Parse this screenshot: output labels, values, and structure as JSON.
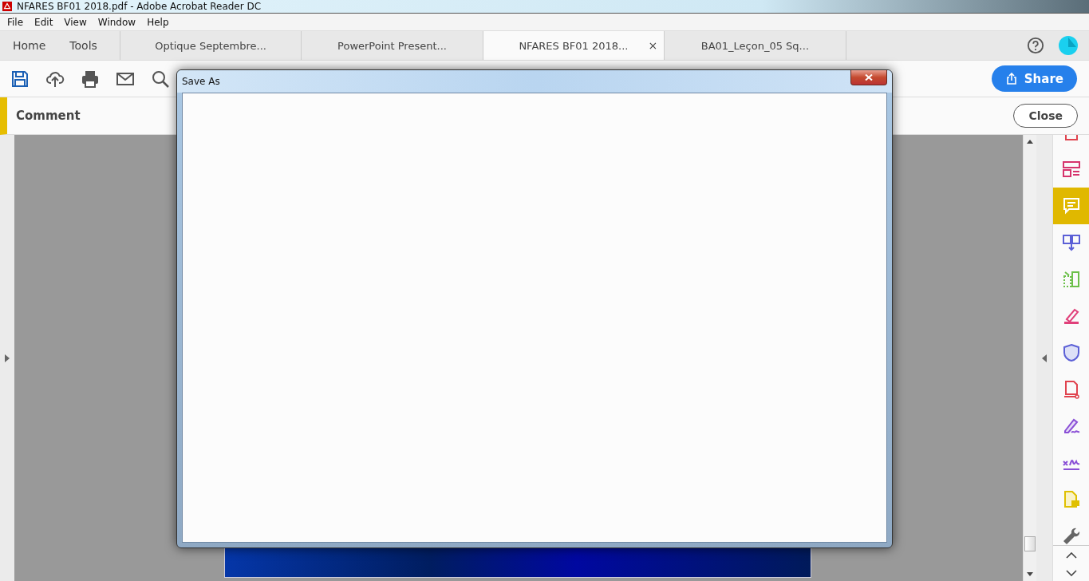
{
  "window": {
    "title": "NFARES BF01 2018.pdf - Adobe Acrobat Reader DC"
  },
  "menu": [
    "File",
    "Edit",
    "View",
    "Window",
    "Help"
  ],
  "tabs": [
    {
      "label": "Home",
      "kind": "nav",
      "selected": false
    },
    {
      "label": "Tools",
      "kind": "nav",
      "selected": false
    },
    {
      "label": "Optique Septembre...",
      "kind": "doc",
      "selected": false
    },
    {
      "label": "PowerPoint Present...",
      "kind": "doc",
      "selected": false
    },
    {
      "label": "NFARES BF01 2018...",
      "kind": "doc",
      "selected": true,
      "close": "×"
    },
    {
      "label": "BA01_Leçon_05 Sq...",
      "kind": "doc",
      "selected": false
    }
  ],
  "toolbar": {
    "share": "Share"
  },
  "panel": {
    "title": "Comment",
    "close": "Close"
  },
  "rail": [
    {
      "kind": "page",
      "color": "#e0434e",
      "selected": false
    },
    {
      "kind": "layout",
      "color": "#d6336c",
      "selected": false
    },
    {
      "kind": "comment",
      "color": "#ffffff",
      "selected": true
    },
    {
      "kind": "combine",
      "color": "#5b5fd6",
      "selected": false
    },
    {
      "kind": "organize",
      "color": "#6cc04a",
      "selected": false
    },
    {
      "kind": "highlight",
      "color": "#e0407a",
      "selected": false
    },
    {
      "kind": "shield",
      "color": "#5b5fd6",
      "selected": false
    },
    {
      "kind": "export",
      "color": "#e0434e",
      "selected": false
    },
    {
      "kind": "sign",
      "color": "#8a4fd6",
      "selected": false
    },
    {
      "kind": "fill",
      "color": "#8a4fd6",
      "selected": false
    },
    {
      "kind": "note",
      "color": "#e0c000",
      "selected": false
    },
    {
      "kind": "wrench",
      "color": "#666666",
      "selected": false
    }
  ],
  "dialog": {
    "title": "Save As"
  }
}
